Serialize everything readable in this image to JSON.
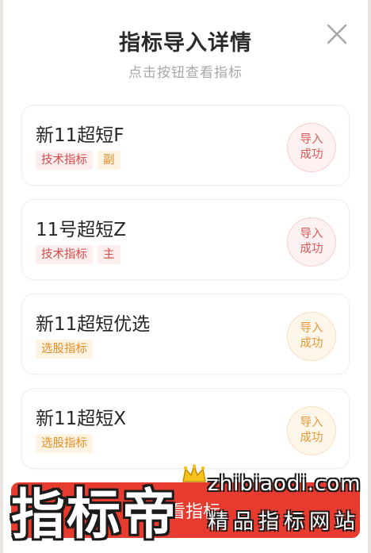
{
  "header": {
    "title": "指标导入详情",
    "subtitle": "点击按钮查看指标"
  },
  "icons": {
    "close": "close-icon",
    "crown": "crown-icon"
  },
  "items": [
    {
      "name": "新11超短F",
      "tags": [
        {
          "label": "技术指标",
          "tone": "red"
        },
        {
          "label": "副",
          "tone": "orange"
        }
      ],
      "status": [
        "导入",
        "成功"
      ],
      "status_tone": "red"
    },
    {
      "name": "11号超短Z",
      "tags": [
        {
          "label": "技术指标",
          "tone": "red"
        },
        {
          "label": "主",
          "tone": "red"
        }
      ],
      "status": [
        "导入",
        "成功"
      ],
      "status_tone": "red"
    },
    {
      "name": "新11超短优选",
      "tags": [
        {
          "label": "选股指标",
          "tone": "orange"
        }
      ],
      "status": [
        "导入",
        "成功"
      ],
      "status_tone": "orange"
    },
    {
      "name": "新11超短X",
      "tags": [
        {
          "label": "选股指标",
          "tone": "orange"
        }
      ],
      "status": [
        "导入",
        "成功"
      ],
      "status_tone": "orange"
    }
  ],
  "bottom_button": {
    "label": "查看指标"
  },
  "watermark": {
    "big_text": "指标帝",
    "domain": "zhibiaodi.com",
    "tagline": "精品指标网站"
  },
  "colors": {
    "accent_red": "#e63b2e",
    "tag_red": "#d24a4a",
    "tag_orange": "#e58e25"
  }
}
